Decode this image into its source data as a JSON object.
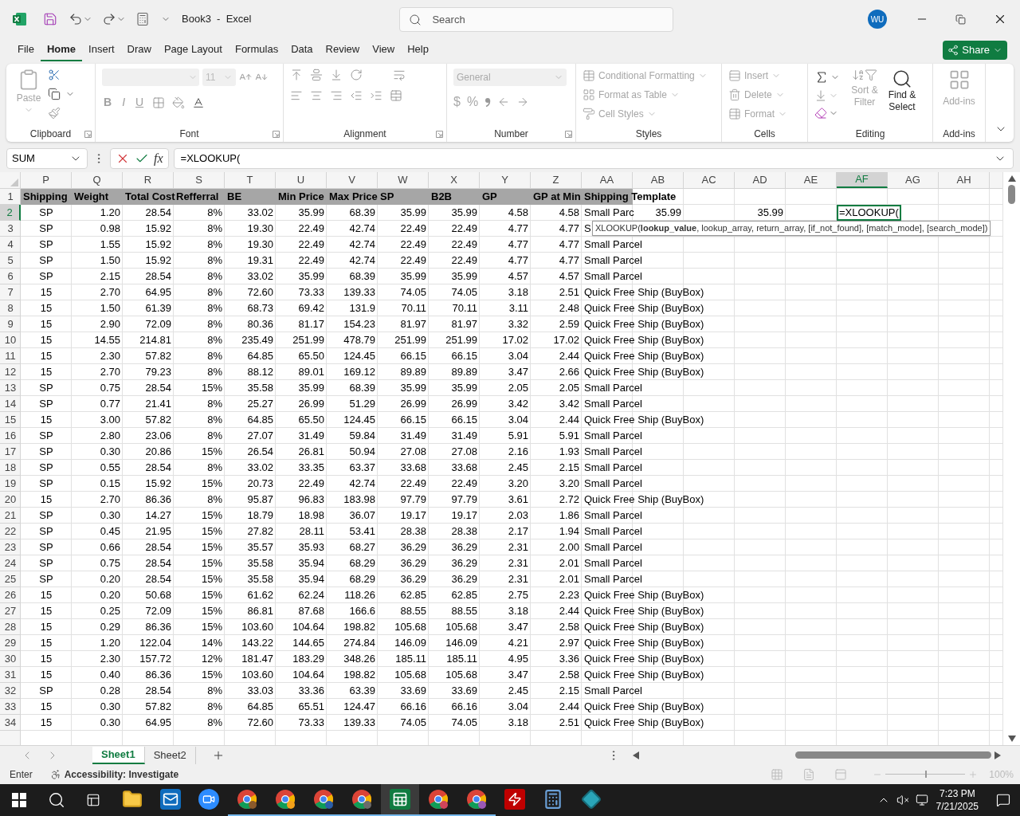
{
  "title_bar": {
    "title": "Book3  -  Excel",
    "search": {
      "placeholder": "Search"
    },
    "account": {
      "initials": "WU"
    }
  },
  "menu_tabs": [
    {
      "label": "File",
      "selected": false
    },
    {
      "label": "Home",
      "selected": true
    },
    {
      "label": "Insert",
      "selected": false
    },
    {
      "label": "Draw",
      "selected": false
    },
    {
      "label": "Page Layout",
      "selected": false
    },
    {
      "label": "Formulas",
      "selected": false
    },
    {
      "label": "Data",
      "selected": false
    },
    {
      "label": "Review",
      "selected": false
    },
    {
      "label": "View",
      "selected": false
    },
    {
      "label": "Help",
      "selected": false
    }
  ],
  "share": {
    "label": "Share"
  },
  "ribbon": {
    "clipboard": {
      "label": "Clipboard",
      "paste": {
        "label": "Paste",
        "disabled": true
      }
    },
    "font": {
      "label": "Font",
      "size": "11",
      "bold": "B",
      "italic": "I",
      "underline": "U"
    },
    "alignment": {
      "label": "Alignment"
    },
    "number": {
      "label": "Number",
      "format": "General",
      "currency": "$",
      "percent": "%"
    },
    "styles": {
      "label": "Styles",
      "commands": [
        {
          "label": "Conditional Formatting",
          "disabled": true
        },
        {
          "label": "Format as Table",
          "disabled": true
        },
        {
          "label": "Cell Styles",
          "disabled": true
        }
      ]
    },
    "cells": {
      "label": "Cells",
      "commands": [
        {
          "label": "Insert",
          "disabled": true
        },
        {
          "label": "Delete",
          "disabled": true
        },
        {
          "label": "Format",
          "disabled": true
        }
      ]
    },
    "editing": {
      "label": "Editing",
      "sort": {
        "label": "Sort & Filter",
        "disabled": true
      },
      "find": {
        "label": "Find & Select",
        "disabled": false
      }
    },
    "addins": {
      "label": "Add-ins",
      "button": {
        "label": "Add-ins",
        "disabled": true
      }
    }
  },
  "formula_bar": {
    "name_box": "SUM",
    "insert_function": "fx",
    "formula": "=XLOOKUP("
  },
  "columns": [
    {
      "label": "P",
      "selected": false
    },
    {
      "label": "Q",
      "selected": false
    },
    {
      "label": "R",
      "selected": false
    },
    {
      "label": "S",
      "selected": false
    },
    {
      "label": "T",
      "selected": false
    },
    {
      "label": "U",
      "selected": false
    },
    {
      "label": "V",
      "selected": false
    },
    {
      "label": "W",
      "selected": false
    },
    {
      "label": "X",
      "selected": false
    },
    {
      "label": "Y",
      "selected": false
    },
    {
      "label": "Z",
      "selected": false
    },
    {
      "label": "AA",
      "selected": false
    },
    {
      "label": "AB",
      "selected": false
    },
    {
      "label": "AC",
      "selected": false
    },
    {
      "label": "AD",
      "selected": false
    },
    {
      "label": "AE",
      "selected": false
    },
    {
      "label": "AF",
      "selected": true
    },
    {
      "label": "AG",
      "selected": false
    },
    {
      "label": "AH",
      "selected": false
    }
  ],
  "rows": [
    {
      "number": "1",
      "selected": false,
      "kind": "header",
      "cells": [
        "Shipping",
        "Weight",
        "Total Cost",
        "Refferral",
        "BE",
        "Min Price",
        "Max Price",
        "SP",
        "B2B",
        "GP",
        "GP at Min",
        "Shipping Template"
      ]
    },
    {
      "number": "2",
      "selected": true,
      "kind": "data",
      "cells": [
        "SP",
        "1.20",
        "28.54",
        "8%",
        "33.02",
        "35.99",
        "68.39",
        "35.99",
        "35.99",
        "4.58",
        "4.58",
        "Small Parc"
      ],
      "extra": [
        {
          "kind": "value",
          "value": "35.99"
        },
        {
          "kind": "blank"
        },
        {
          "kind": "value",
          "value": "35.99"
        },
        {
          "kind": "blank"
        },
        {
          "kind": "active",
          "value": "=XLOOKUP("
        }
      ]
    },
    {
      "number": "3",
      "selected": false,
      "kind": "data",
      "cells": [
        "SP",
        "0.98",
        "15.92",
        "8%",
        "19.30",
        "22.49",
        "42.74",
        "22.49",
        "22.49",
        "4.77",
        "4.77",
        "S"
      ]
    },
    {
      "number": "4",
      "selected": false,
      "kind": "data",
      "cells": [
        "SP",
        "1.55",
        "15.92",
        "8%",
        "19.30",
        "22.49",
        "42.74",
        "22.49",
        "22.49",
        "4.77",
        "4.77",
        "Small Parcel"
      ]
    },
    {
      "number": "5",
      "selected": false,
      "kind": "data",
      "cells": [
        "SP",
        "1.50",
        "15.92",
        "8%",
        "19.31",
        "22.49",
        "42.74",
        "22.49",
        "22.49",
        "4.77",
        "4.77",
        "Small Parcel"
      ]
    },
    {
      "number": "6",
      "selected": false,
      "kind": "data",
      "cells": [
        "SP",
        "2.15",
        "28.54",
        "8%",
        "33.02",
        "35.99",
        "68.39",
        "35.99",
        "35.99",
        "4.57",
        "4.57",
        "Small Parcel"
      ]
    },
    {
      "number": "7",
      "selected": false,
      "kind": "data",
      "cells": [
        "15",
        "2.70",
        "64.95",
        "8%",
        "72.60",
        "73.33",
        "139.33",
        "74.05",
        "74.05",
        "3.18",
        "2.51",
        "Quick Free Ship (BuyBox)"
      ]
    },
    {
      "number": "8",
      "selected": false,
      "kind": "data",
      "cells": [
        "15",
        "1.50",
        "61.39",
        "8%",
        "68.73",
        "69.42",
        "131.9",
        "70.11",
        "70.11",
        "3.11",
        "2.48",
        "Quick Free Ship (BuyBox)"
      ]
    },
    {
      "number": "9",
      "selected": false,
      "kind": "data",
      "cells": [
        "15",
        "2.90",
        "72.09",
        "8%",
        "80.36",
        "81.17",
        "154.23",
        "81.97",
        "81.97",
        "3.32",
        "2.59",
        "Quick Free Ship (BuyBox)"
      ]
    },
    {
      "number": "10",
      "selected": false,
      "kind": "data",
      "cells": [
        "15",
        "14.55",
        "214.81",
        "8%",
        "235.49",
        "251.99",
        "478.79",
        "251.99",
        "251.99",
        "17.02",
        "17.02",
        "Quick Free Ship (BuyBox)"
      ]
    },
    {
      "number": "11",
      "selected": false,
      "kind": "data",
      "cells": [
        "15",
        "2.30",
        "57.82",
        "8%",
        "64.85",
        "65.50",
        "124.45",
        "66.15",
        "66.15",
        "3.04",
        "2.44",
        "Quick Free Ship (BuyBox)"
      ]
    },
    {
      "number": "12",
      "selected": false,
      "kind": "data",
      "cells": [
        "15",
        "2.70",
        "79.23",
        "8%",
        "88.12",
        "89.01",
        "169.12",
        "89.89",
        "89.89",
        "3.47",
        "2.66",
        "Quick Free Ship (BuyBox)"
      ]
    },
    {
      "number": "13",
      "selected": false,
      "kind": "data",
      "cells": [
        "SP",
        "0.75",
        "28.54",
        "15%",
        "35.58",
        "35.99",
        "68.39",
        "35.99",
        "35.99",
        "2.05",
        "2.05",
        "Small Parcel"
      ]
    },
    {
      "number": "14",
      "selected": false,
      "kind": "data",
      "cells": [
        "SP",
        "0.77",
        "21.41",
        "8%",
        "25.27",
        "26.99",
        "51.29",
        "26.99",
        "26.99",
        "3.42",
        "3.42",
        "Small Parcel"
      ]
    },
    {
      "number": "15",
      "selected": false,
      "kind": "data",
      "cells": [
        "15",
        "3.00",
        "57.82",
        "8%",
        "64.85",
        "65.50",
        "124.45",
        "66.15",
        "66.15",
        "3.04",
        "2.44",
        "Quick Free Ship (BuyBox)"
      ]
    },
    {
      "number": "16",
      "selected": false,
      "kind": "data",
      "cells": [
        "SP",
        "2.80",
        "23.06",
        "8%",
        "27.07",
        "31.49",
        "59.84",
        "31.49",
        "31.49",
        "5.91",
        "5.91",
        "Small Parcel"
      ]
    },
    {
      "number": "17",
      "selected": false,
      "kind": "data",
      "cells": [
        "SP",
        "0.30",
        "20.86",
        "15%",
        "26.54",
        "26.81",
        "50.94",
        "27.08",
        "27.08",
        "2.16",
        "1.93",
        "Small Parcel"
      ]
    },
    {
      "number": "18",
      "selected": false,
      "kind": "data",
      "cells": [
        "SP",
        "0.55",
        "28.54",
        "8%",
        "33.02",
        "33.35",
        "63.37",
        "33.68",
        "33.68",
        "2.45",
        "2.15",
        "Small Parcel"
      ]
    },
    {
      "number": "19",
      "selected": false,
      "kind": "data",
      "cells": [
        "SP",
        "0.15",
        "15.92",
        "15%",
        "20.73",
        "22.49",
        "42.74",
        "22.49",
        "22.49",
        "3.20",
        "3.20",
        "Small Parcel"
      ]
    },
    {
      "number": "20",
      "selected": false,
      "kind": "data",
      "cells": [
        "15",
        "2.70",
        "86.36",
        "8%",
        "95.87",
        "96.83",
        "183.98",
        "97.79",
        "97.79",
        "3.61",
        "2.72",
        "Quick Free Ship (BuyBox)"
      ]
    },
    {
      "number": "21",
      "selected": false,
      "kind": "data",
      "cells": [
        "SP",
        "0.30",
        "14.27",
        "15%",
        "18.79",
        "18.98",
        "36.07",
        "19.17",
        "19.17",
        "2.03",
        "1.86",
        "Small Parcel"
      ]
    },
    {
      "number": "22",
      "selected": false,
      "kind": "data",
      "cells": [
        "SP",
        "0.45",
        "21.95",
        "15%",
        "27.82",
        "28.11",
        "53.41",
        "28.38",
        "28.38",
        "2.17",
        "1.94",
        "Small Parcel"
      ]
    },
    {
      "number": "23",
      "selected": false,
      "kind": "data",
      "cells": [
        "SP",
        "0.66",
        "28.54",
        "15%",
        "35.57",
        "35.93",
        "68.27",
        "36.29",
        "36.29",
        "2.31",
        "2.00",
        "Small Parcel"
      ]
    },
    {
      "number": "24",
      "selected": false,
      "kind": "data",
      "cells": [
        "SP",
        "0.75",
        "28.54",
        "15%",
        "35.58",
        "35.94",
        "68.29",
        "36.29",
        "36.29",
        "2.31",
        "2.01",
        "Small Parcel"
      ]
    },
    {
      "number": "25",
      "selected": false,
      "kind": "data",
      "cells": [
        "SP",
        "0.20",
        "28.54",
        "15%",
        "35.58",
        "35.94",
        "68.29",
        "36.29",
        "36.29",
        "2.31",
        "2.01",
        "Small Parcel"
      ]
    },
    {
      "number": "26",
      "selected": false,
      "kind": "data",
      "cells": [
        "15",
        "0.20",
        "50.68",
        "15%",
        "61.62",
        "62.24",
        "118.26",
        "62.85",
        "62.85",
        "2.75",
        "2.23",
        "Quick Free Ship (BuyBox)"
      ]
    },
    {
      "number": "27",
      "selected": false,
      "kind": "data",
      "cells": [
        "15",
        "0.25",
        "72.09",
        "15%",
        "86.81",
        "87.68",
        "166.6",
        "88.55",
        "88.55",
        "3.18",
        "2.44",
        "Quick Free Ship (BuyBox)"
      ]
    },
    {
      "number": "28",
      "selected": false,
      "kind": "data",
      "cells": [
        "15",
        "0.29",
        "86.36",
        "15%",
        "103.60",
        "104.64",
        "198.82",
        "105.68",
        "105.68",
        "3.47",
        "2.58",
        "Quick Free Ship (BuyBox)"
      ]
    },
    {
      "number": "29",
      "selected": false,
      "kind": "data",
      "cells": [
        "15",
        "1.20",
        "122.04",
        "14%",
        "143.22",
        "144.65",
        "274.84",
        "146.09",
        "146.09",
        "4.21",
        "2.97",
        "Quick Free Ship (BuyBox)"
      ]
    },
    {
      "number": "30",
      "selected": false,
      "kind": "data",
      "cells": [
        "15",
        "2.30",
        "157.72",
        "12%",
        "181.47",
        "183.29",
        "348.26",
        "185.11",
        "185.11",
        "4.95",
        "3.36",
        "Quick Free Ship (BuyBox)"
      ]
    },
    {
      "number": "31",
      "selected": false,
      "kind": "data",
      "cells": [
        "15",
        "0.40",
        "86.36",
        "15%",
        "103.60",
        "104.64",
        "198.82",
        "105.68",
        "105.68",
        "3.47",
        "2.58",
        "Quick Free Ship (BuyBox)"
      ]
    },
    {
      "number": "32",
      "selected": false,
      "kind": "data",
      "cells": [
        "SP",
        "0.28",
        "28.54",
        "8%",
        "33.03",
        "33.36",
        "63.39",
        "33.69",
        "33.69",
        "2.45",
        "2.15",
        "Small Parcel"
      ]
    },
    {
      "number": "33",
      "selected": false,
      "kind": "data",
      "cells": [
        "15",
        "0.30",
        "57.82",
        "8%",
        "64.85",
        "65.51",
        "124.47",
        "66.16",
        "66.16",
        "3.04",
        "2.44",
        "Quick Free Ship (BuyBox)"
      ]
    },
    {
      "number": "34",
      "selected": false,
      "kind": "data",
      "cells": [
        "15",
        "0.30",
        "64.95",
        "8%",
        "72.60",
        "73.33",
        "139.33",
        "74.05",
        "74.05",
        "3.18",
        "2.51",
        "Quick Free Ship (BuyBox)"
      ]
    }
  ],
  "tooltip": {
    "text": "XLOOKUP(**lookup_value**, lookup_array, return_array, [if_not_found], [match_mode], [search_mode])"
  },
  "sheets": [
    {
      "label": "Sheet1",
      "selected": true
    },
    {
      "label": "Sheet2",
      "selected": false
    }
  ],
  "status_bar": {
    "mode": "Enter",
    "accessibility": "Accessibility: Investigate",
    "zoom": "100%",
    "zoom_slider": {
      "level": 0.5
    }
  },
  "taskbar": {
    "apps": [
      {
        "kind": "folder",
        "running": false,
        "active": false
      },
      {
        "kind": "mail",
        "running": false,
        "active": false
      },
      {
        "kind": "video",
        "running": false,
        "active": false
      },
      {
        "kind": "browser",
        "running": true,
        "active": false,
        "color": "#8b5a2b"
      },
      {
        "kind": "browser",
        "running": true,
        "active": false,
        "color": "#f4a11a"
      },
      {
        "kind": "browser",
        "running": true,
        "active": false,
        "color": "#2b5ea8"
      },
      {
        "kind": "browser",
        "running": true,
        "active": false,
        "color": "#6b6b6b"
      },
      {
        "kind": "sheet",
        "running": true,
        "active": true
      },
      {
        "kind": "browser",
        "running": true,
        "active": false,
        "color": "#d0455a"
      },
      {
        "kind": "browser",
        "running": true,
        "active": false,
        "color": "#9b59b6"
      },
      {
        "kind": "ftp",
        "running": false,
        "active": false
      },
      {
        "kind": "calculator",
        "running": false,
        "active": false
      },
      {
        "kind": "diamond",
        "running": false,
        "active": false
      }
    ],
    "time": "7:23 PM",
    "date": "7/21/2025"
  }
}
